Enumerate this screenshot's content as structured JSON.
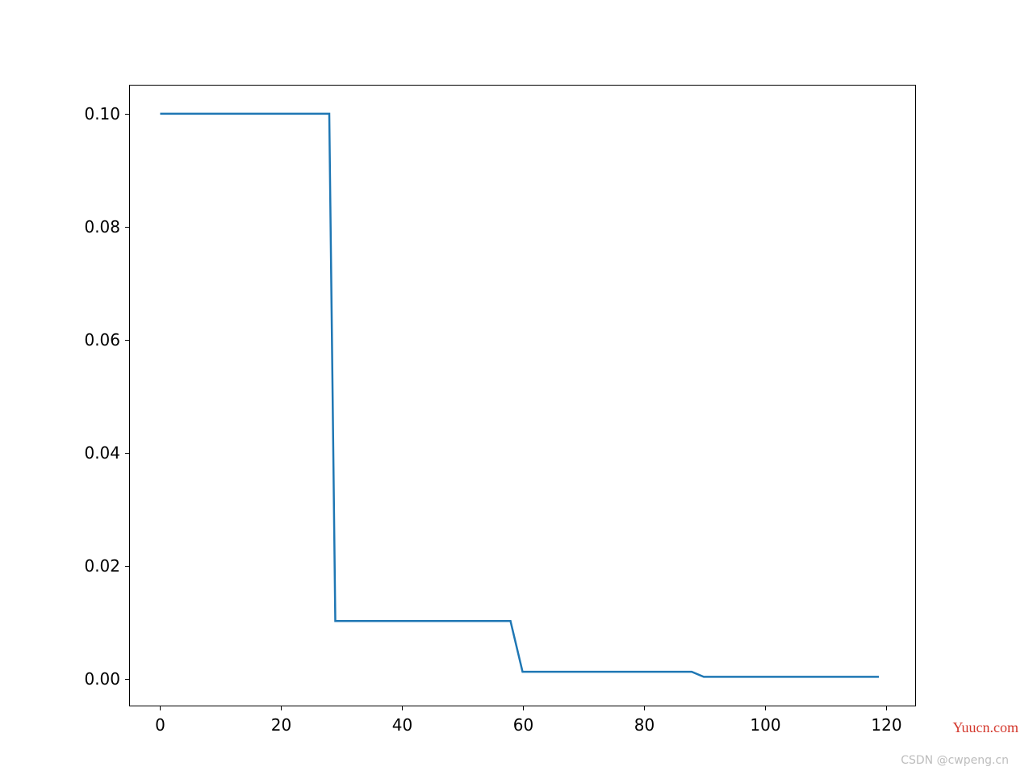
{
  "chart_data": {
    "type": "line",
    "x": [
      0,
      28,
      29,
      58,
      60,
      88,
      90,
      119
    ],
    "y": [
      0.1,
      0.1,
      0.01,
      0.01,
      0.001,
      0.001,
      0.0001,
      0.0001
    ],
    "title": "",
    "xlabel": "",
    "ylabel": "",
    "xlim": [
      -5,
      125
    ],
    "ylim": [
      -0.005,
      0.105
    ],
    "x_ticks": [
      0,
      20,
      40,
      60,
      80,
      100,
      120
    ],
    "x_tick_labels": [
      "0",
      "20",
      "40",
      "60",
      "80",
      "100",
      "120"
    ],
    "y_ticks": [
      0.0,
      0.02,
      0.04,
      0.06,
      0.08,
      0.1
    ],
    "y_tick_labels": [
      "0.00",
      "0.02",
      "0.04",
      "0.06",
      "0.08",
      "0.10"
    ],
    "line_color": "#1f77b4"
  },
  "watermarks": {
    "right": "Yuucn.com",
    "bottom": "CSDN @cwpeng.cn"
  }
}
